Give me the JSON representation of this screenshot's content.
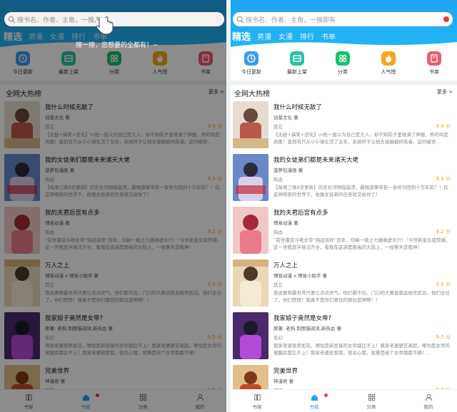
{
  "search": {
    "placeholder": "搜书名、作者、主角，一搜即有"
  },
  "tip": "搜一搜，您想要的全都有！~",
  "tabs": [
    {
      "label": "精选",
      "active": true
    },
    {
      "label": "男漫"
    },
    {
      "label": "女漫"
    },
    {
      "label": "排行"
    },
    {
      "label": "书单"
    }
  ],
  "categories": [
    {
      "label": "今日更新",
      "icon": "clock-icon",
      "color": "#3d9af2"
    },
    {
      "label": "最新上架",
      "icon": "shelf-icon",
      "color": "#29c2a7"
    },
    {
      "label": "分类",
      "icon": "grid-icon",
      "color": "#19c26a"
    },
    {
      "label": "人气榜",
      "icon": "fire-icon",
      "color": "#f5a623"
    },
    {
      "label": "书单",
      "icon": "book-icon",
      "color": "#ef5a6e"
    }
  ],
  "section": {
    "title": "全网大热榜",
    "more": "更多 >"
  },
  "books": [
    {
      "title": "我什么时候无敌了",
      "author": "创基文化 著",
      "genre": "其它",
      "score": "9.4 分",
      "desc": "【无敌+搞笑+逆化】\\n他一直以为自己是凡人，却不知院子里堆满了神器，养的鸡是凤凰！直到有只从小小镇生活了五年，系统终于让他去接触被修炼者。这时被修..."
    },
    {
      "title": "我的女徒弟们都是未来诸天大佬",
      "author": "菠萝包漫画 著",
      "genre": "热血",
      "score": "8.5 分",
      "desc": "【每周三晚9点更新】历史长河侧临崩溃，最强道尊带若一身修为回到十万年前？！在这神明丧的世界下，收服女徒弟的任务就交给你了！"
    },
    {
      "title": "我的夫君后宫有点多",
      "author": "博易动漫 著",
      "genre": "热血",
      "score": "9.2 分",
      "desc": "“前世遭受冷艳女帝“强迫双修”百年，切掉一棱之力遁离虚天穴！”今世新皇生成赘婿，这一世我武学境法齐全，看我在这满是那高的大陆上，一柱擎天定乾坤！"
    },
    {
      "title": "万人之上",
      "author": "博易动漫 x 博易小助手 著",
      "genre": "其它",
      "score": "9.0 分",
      "desc": "我说要称霸世界只差亿点点灵气。他们都不信。门口的大黄说我会她世武功。他们全位了，你们慌慌！我真不是你们要找的那位武神啊！！"
    },
    {
      "title": "我家娘子竟然是女帝?",
      "author": "原著: 老狗,制图猫阅读,新热血 著",
      "genre": "玄幻",
      "score": "9.5 分",
      "desc": "我家老婆貌美如花，哪怕是新登基的女帝都比不上！我家老婆厨艺高超，哪怕是女帝的御膳房都比不上！我家老婆很爱我，很关心我，就算是给个女帝我都不换！..."
    },
    {
      "title": "完美世界",
      "author": "神漫君 著",
      "genre": "其它",
      "score": "8.6 分",
      "desc": ""
    }
  ],
  "tabbar": [
    {
      "label": "书架",
      "icon": "shelf-icon"
    },
    {
      "label": "书城",
      "icon": "home-icon",
      "active": true
    },
    {
      "label": "分类",
      "icon": "grid-icon"
    },
    {
      "label": "我的",
      "icon": "user-icon"
    }
  ],
  "colors": {
    "accent": "#1ea6ee",
    "score": "#f0a020",
    "badge": "#e73b3b"
  }
}
